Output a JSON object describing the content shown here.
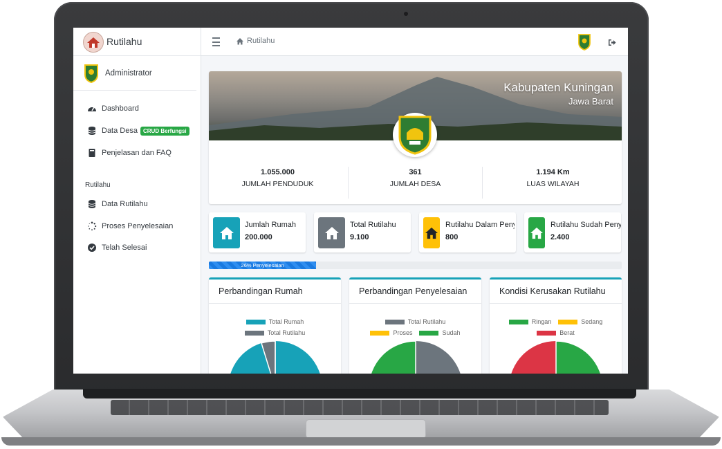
{
  "sidebar": {
    "brand": "Rutilahu",
    "user": "Administrator",
    "items": [
      {
        "label": "Dashboard"
      },
      {
        "label": "Data Desa",
        "badge": "CRUD Berfungsi"
      },
      {
        "label": "Penjelasan dan FAQ"
      }
    ],
    "section_header": "Rutilahu",
    "section_items": [
      {
        "label": "Data Rutilahu"
      },
      {
        "label": "Proses Penyelesaian"
      },
      {
        "label": "Telah Selesai"
      }
    ]
  },
  "topbar": {
    "breadcrumb": "Rutilahu"
  },
  "hero": {
    "title": "Kabupaten Kuningan",
    "subtitle": "Jawa Barat",
    "stats": [
      {
        "value": "1.055.000",
        "label": "JUMLAH PENDUDUK"
      },
      {
        "value": "361",
        "label": "JUMLAH DESA"
      },
      {
        "value": "1.194 Km",
        "label": "LUAS WILAYAH"
      }
    ]
  },
  "info_boxes": [
    {
      "title": "Jumlah Rumah",
      "value": "200.000",
      "color": "#17a2b8"
    },
    {
      "title": "Total Rutilahu",
      "value": "9.100",
      "color": "#6c757d"
    },
    {
      "title": "Rutilahu Dalam Penyelesaian",
      "value": "800",
      "color": "#ffc107"
    },
    {
      "title": "Rutilahu Sudah Penyelesaian",
      "value": "2.400",
      "color": "#28a745"
    }
  ],
  "progress": {
    "label": "26% Penyelesaian",
    "percent": 26
  },
  "charts": [
    {
      "title": "Perbandingan Rumah",
      "legend": [
        {
          "label": "Total Rumah",
          "color": "#17a2b8"
        },
        {
          "label": "Total Rutilahu",
          "color": "#6c757d"
        }
      ]
    },
    {
      "title": "Perbandingan Penyelesaian",
      "legend": [
        {
          "label": "Total Rutilahu",
          "color": "#6c757d"
        },
        {
          "label": "Proses",
          "color": "#ffc107"
        },
        {
          "label": "Sudah",
          "color": "#28a745"
        }
      ]
    },
    {
      "title": "Kondisi Kerusakan Rutilahu",
      "legend": [
        {
          "label": "Ringan",
          "color": "#28a745"
        },
        {
          "label": "Sedang",
          "color": "#ffc107"
        },
        {
          "label": "Berat",
          "color": "#dc3545"
        }
      ]
    }
  ]
}
